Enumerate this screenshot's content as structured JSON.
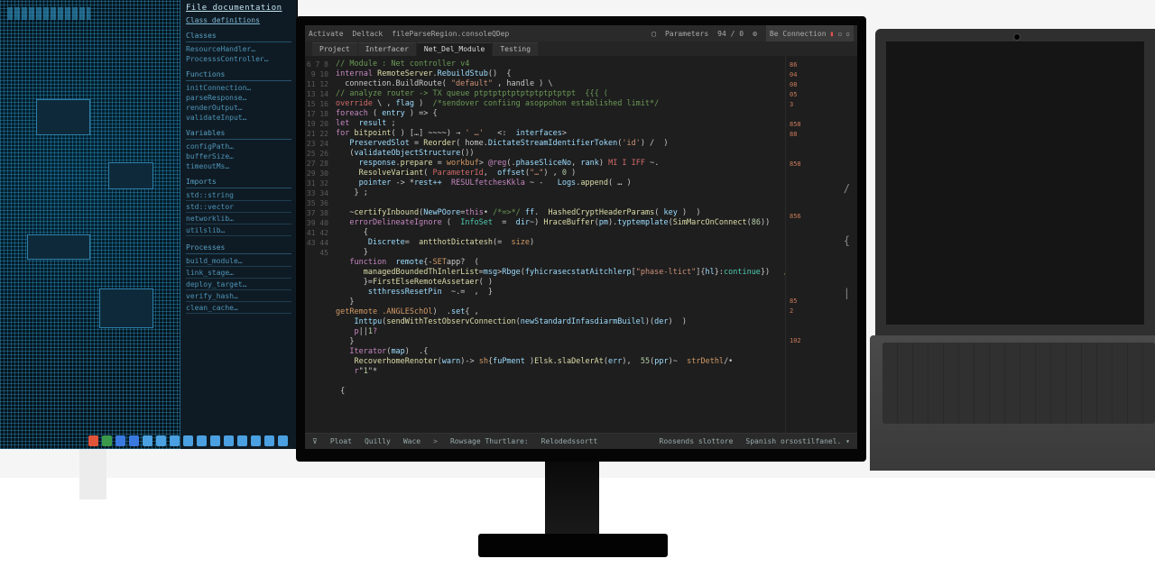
{
  "left_panel": {
    "header": "File   documentation",
    "subheader": "Class   definitions",
    "sections": [
      {
        "title": "Classes",
        "items": [
          "ResourceHandler…",
          "ProcesssController…"
        ]
      },
      {
        "title": "Functions",
        "items": [
          "initConnection…",
          "parseResponse…",
          "renderOutput…",
          "validateInput…"
        ]
      },
      {
        "title": "Variables",
        "items": [
          "configPath…",
          "bufferSize…",
          "timeoutMs…"
        ]
      },
      {
        "title": "Imports",
        "items": [
          "std::string",
          "std::vector",
          "networklib…",
          "utilslib…"
        ]
      },
      {
        "title": "Processes",
        "items": [
          "build_module…",
          "link_stage…",
          "deploy_target…",
          "verify_hash…",
          "clean_cache…"
        ]
      }
    ]
  },
  "taskbar_colors": [
    "#e0543a",
    "#3a9a4a",
    "#3a7ae0",
    "#3a7ae0",
    "#4aa0e0",
    "#4aa0e0",
    "#4aa0e0",
    "#4aa0e0",
    "#4aa0e0",
    "#4aa0e0",
    "#4aa0e0",
    "#4aa0e0",
    "#4aa0e0",
    "#4aa0e0",
    "#4aa0e0"
  ],
  "editor": {
    "titlebar": {
      "left_items": [
        "Activate",
        "Deltack",
        "fileParseRegion.consoleQDep"
      ],
      "right_label": "Parameters",
      "right_nums": "94  /  0",
      "right_mode": "Be  Connection"
    },
    "tabs": [
      {
        "label": "Project",
        "active": false
      },
      {
        "label": "Interfacer",
        "active": false
      },
      {
        "label": "Net_Del_Module",
        "active": true
      },
      {
        "label": "Testing",
        "active": false
      }
    ],
    "gutter_start": 6,
    "gutter_count": 40,
    "code_lines": [
      "<span class='tok-com'>// Module : Net controller v4</span>",
      "<span class='tok-kw'>internal</span> <span class='tok-fn'>RemoteServer</span>.<span class='tok-var'>RebuildStub</span>()  {",
      "  connection.BuildRoute( <span class='tok-str'>\"default\"</span> , handle ) \\",
      "<span class='tok-com'>// analyze router -&gt; TX queue ptptptptptptptptptptpt  {{{ (</span>",
      "<span class='tok-red'>override</span> \\ , <span class='tok-var'>flag</span> )  <span class='tok-com'>/*sendover confiing asoppohon established limit*/</span>",
      "<span class='tok-kw'>foreach</span> ( <span class='tok-var'>entry</span> ) =&gt; {",
      "<span class='tok-kw'>let</span>  <span class='tok-var'>result</span> ;",
      "<span class='tok-kw'>for</span> <span class='tok-fn'>bitpoint</span>( ) […] <span class='tok-op'>~~~~</span>) → <span class='tok-str'>' …'</span>   &lt;:  <span class='tok-var'>interfaces</span>&gt;",
      "   <span class='tok-var'>PreservedSlot</span> = <span class='tok-fn'>Reorder</span>( home.<span class='tok-var'>DictateStreamIdentifierToken</span>(<span class='tok-str'>'id'</span>) /  )",
      "   (<span class='tok-var'>validateObjectStructure</span>())",
      "     <span class='tok-var'>response</span>.<span class='tok-fn'>prepare</span> = <span class='tok-orange'>workbuf</span>&gt; <span class='tok-mag'>@reg</span>(.<span class='tok-var'>phaseSliceNo</span>, <span class='tok-var'>rank</span>) <span class='tok-red'>MI I IFF</span> ~.",
      "     <span class='tok-fn'>ResolveVariant</span>( <span class='tok-red'>ParameterId</span>,  <span class='tok-var'>offset</span>(<span class='tok-str'>\"…\"</span>) , <span class='tok-num'>0</span> )",
      "     <span class='tok-var'>pointer</span> -&gt; *<span class='tok-var'>rest++</span>  <span class='tok-mag'>RESULfetchesKkla</span> ~ -   <span class='tok-var'>Logs</span>.<span class='tok-fn'>append</span>( <span class='tok-op'>…</span> )",
      "    } ;",
      "",
      "   ~<span class='tok-fn'>certifyInbound</span>(<span class='tok-var'>NewPOore</span>=<span class='tok-kw'>this</span>• <span class='tok-com'>/*=&gt;*/</span> <span class='tok-var'>ff</span>.  <span class='tok-fn'>HashedCryptHeaderParams</span>( <span class='tok-var'>key</span> )  )",
      "   <span class='tok-mag'>errorDelineateIgnore</span> (  <span class='tok-type'>InfoSet</span>  =  <span class='tok-var'>dir</span>~) <span class='tok-fn'>HraceBuffer</span>(<span class='tok-var'>pm</span>).<span class='tok-var'>typtemplate</span>(<span class='tok-fn'>SimMarcOnConnect</span>(<span class='tok-num'>86</span>))",
      "      {",
      "       <span class='tok-var'>Discrete</span>=  <span class='tok-fn'>antthotDictatesh</span>(=  <span class='tok-orange'>size</span>)",
      "      }",
      "   <span class='tok-kw'>function</span>  <span class='tok-var'>remote</span>{-<span class='tok-orange'>SET</span>app?  (",
      "      <span class='tok-fn'>managedBoundedThInlerList</span>=<span class='tok-var'>msg</span>&gt;<span class='tok-var'>Rbge</span>(<span class='tok-var'>fyhicrasecstatAitchlerp</span>[<span class='tok-str'>\"phase-ltict\"</span>]{<span class='tok-var'>hl</span>}:<span class='tok-type'>continue</span>})   <span class='tok-com'>//<span class='tok-orange'>structure:</span></span>",
      "      }=<span class='tok-fn'>FirstElseRemoteAssetaer</span>( )",
      "       <span class='tok-var'>stthressResetPin</span>  ~.=  ,  }",
      "   }",
      "<span class='tok-orange'>getRemote</span> <span class='tok-orange'>.ANGLESchOl</span>)  .<span class='tok-var'>set</span>{ ,",
      "    <span class='tok-var'>Inttpu</span>(<span class='tok-fn'>sendWithTestObservConnection</span>(<span class='tok-var'>newStandardInfasdiarmBuilel</span>)(<span class='tok-var'>der</span>)  )",
      "    <span class='tok-mag'>p</span>||<span class='tok-num'>1</span><span class='tok-mag'>?</span>",
      "   }",
      "   <span class='tok-kw'>Iterator</span>(<span class='tok-var'>map</span>)  .{",
      "    <span class='tok-fn'>RecoverhomeRenoter</span>(<span class='tok-var'>warn</span>)-&gt; <span class='tok-orange'>sh</span>{<span class='tok-var'>fuPment</span> )<span class='tok-fn'>Elsk.slaDelerAt</span>(<span class='tok-var'>err</span>),  <span class='tok-num'>55</span>(<span class='tok-var'>ppr</span>)~  <span class='tok-orange'>strDethl</span>/•",
      "    <span class='tok-mag'>r</span>\"<span class='tok-num'>1</span>\"*",
      "",
      " {"
    ],
    "minimap": {
      "badges": [
        "86",
        "04",
        "08",
        "05",
        "3",
        "",
        "858",
        "88",
        "",
        "",
        "858",
        "",
        "",
        "",
        "856",
        "",
        "",
        "",
        "",
        "",
        "85",
        "2",
        "",
        "",
        "102"
      ],
      "glyphs": [
        "{",
        "",
        "",
        "",
        "|",
        "",
        "",
        "",
        "",
        "",
        "",
        "/",
        "",
        "",
        "",
        "{",
        "",
        "",
        "",
        "|",
        "",
        "",
        "",
        "",
        "|"
      ]
    },
    "statusbar": {
      "left": [
        "⊽",
        "Ploat",
        "Quilly",
        "Wace"
      ],
      "arrow": ">",
      "center": [
        "Rowsage Thurtlare:",
        "Relodedssortt"
      ],
      "right": [
        "Roosends slottore",
        "Spanish   orsostilfanel.   ▾"
      ]
    }
  }
}
